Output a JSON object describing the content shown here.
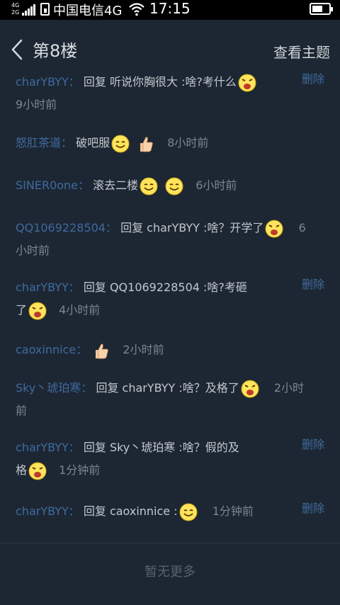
{
  "status_bar": {
    "network_top": "4G",
    "network_bottom": "2G",
    "carrier": "中国电信4G",
    "time": "17:15"
  },
  "header": {
    "title": "第8楼",
    "view_topic": "查看主题"
  },
  "replies": [
    {
      "name": "charYBYY",
      "sep": "：",
      "text1": "回复 听说你胸很大 :啥?考什么",
      "emojis": [
        "shouting-emoji"
      ],
      "text2": "",
      "time": "9小时前",
      "has_delete": true
    },
    {
      "name": "怒肛茶道",
      "sep": "：",
      "text1": "破吧服",
      "emojis": [
        "smile-emoji",
        "thumbs-up-emoji"
      ],
      "text2": "",
      "time": "8小时前",
      "has_delete": false
    },
    {
      "name": "SINER0one",
      "sep": "：",
      "text1": "滚去二楼",
      "emojis": [
        "smile-emoji",
        "smile-emoji"
      ],
      "text2": "",
      "time": "6小时前",
      "has_delete": false
    },
    {
      "name": "QQ1069228504",
      "sep": "：",
      "text1": "回复 charYBYY :啥？开学了",
      "emojis": [
        "shouting-emoji"
      ],
      "text2": "",
      "time_a": "6",
      "time_b": "小时前",
      "has_delete": false
    },
    {
      "name": "charYBYY",
      "sep": "：",
      "text1": "回复 QQ1069228504 :啥?考砸",
      "text1b": "了",
      "emojis": [
        "shouting-emoji"
      ],
      "time": "4小时前",
      "has_delete": true
    },
    {
      "name": "caoxinnice",
      "sep": "：",
      "emojis": [
        "thumbs-up-emoji"
      ],
      "time": "2小时前",
      "has_delete": false
    },
    {
      "name": "Sky丶琥珀寒",
      "sep": "：",
      "text1": "回复 charYBYY :啥？及格了",
      "emojis": [
        "shouting-emoji"
      ],
      "time_a": "2小时",
      "time_b": "前",
      "has_delete": false
    },
    {
      "name": "charYBYY",
      "sep": "：",
      "text1": "回复 Sky丶琥珀寒 :啥？假的及",
      "text1b": "格",
      "emojis": [
        "shouting-emoji"
      ],
      "time": "1分钟前",
      "has_delete": true
    },
    {
      "name": "charYBYY",
      "sep": "：",
      "text1": "回复 caoxinnice :",
      "emojis": [
        "smile-emoji"
      ],
      "time": "1分钟前",
      "has_delete": true
    }
  ],
  "delete_label": "删除",
  "footer": {
    "no_more": "暂无更多"
  },
  "colors": {
    "background": "#1d2733",
    "username": "#3f6aa0",
    "text": "#c2c7cd",
    "time": "#7c8590"
  }
}
